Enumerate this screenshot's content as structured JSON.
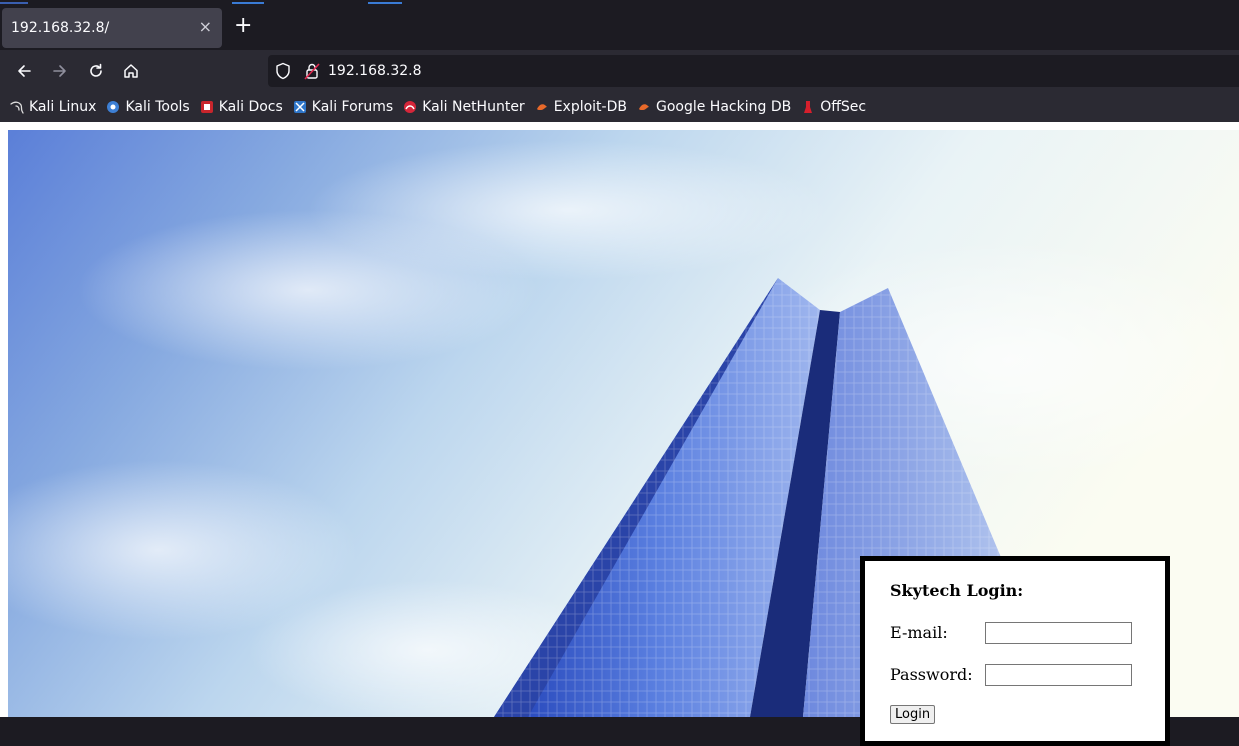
{
  "browser": {
    "tab": {
      "title": "192.168.32.8/",
      "close": "×"
    },
    "new_tab": "+",
    "address": {
      "url": "192.168.32.8"
    },
    "bookmarks": [
      {
        "label": "Kali Linux",
        "icon": "kali-dragon-icon"
      },
      {
        "label": "Kali Tools",
        "icon": "kali-tools-icon"
      },
      {
        "label": "Kali Docs",
        "icon": "kali-docs-icon"
      },
      {
        "label": "Kali Forums",
        "icon": "kali-forums-icon"
      },
      {
        "label": "Kali NetHunter",
        "icon": "nethunter-icon"
      },
      {
        "label": "Exploit-DB",
        "icon": "exploit-db-icon"
      },
      {
        "label": "Google Hacking DB",
        "icon": "ghdb-icon"
      },
      {
        "label": "OffSec",
        "icon": "offsec-icon"
      }
    ]
  },
  "page": {
    "login": {
      "title": "Skytech Login:",
      "email_label": "E-mail:",
      "password_label": "Password:",
      "email_value": "",
      "password_value": "",
      "submit": "Login"
    }
  },
  "colors": {
    "toolbar": "#2b2a33",
    "tabstrip": "#1c1b22",
    "active_tab": "#42414d",
    "text": "#fbfbfe"
  }
}
